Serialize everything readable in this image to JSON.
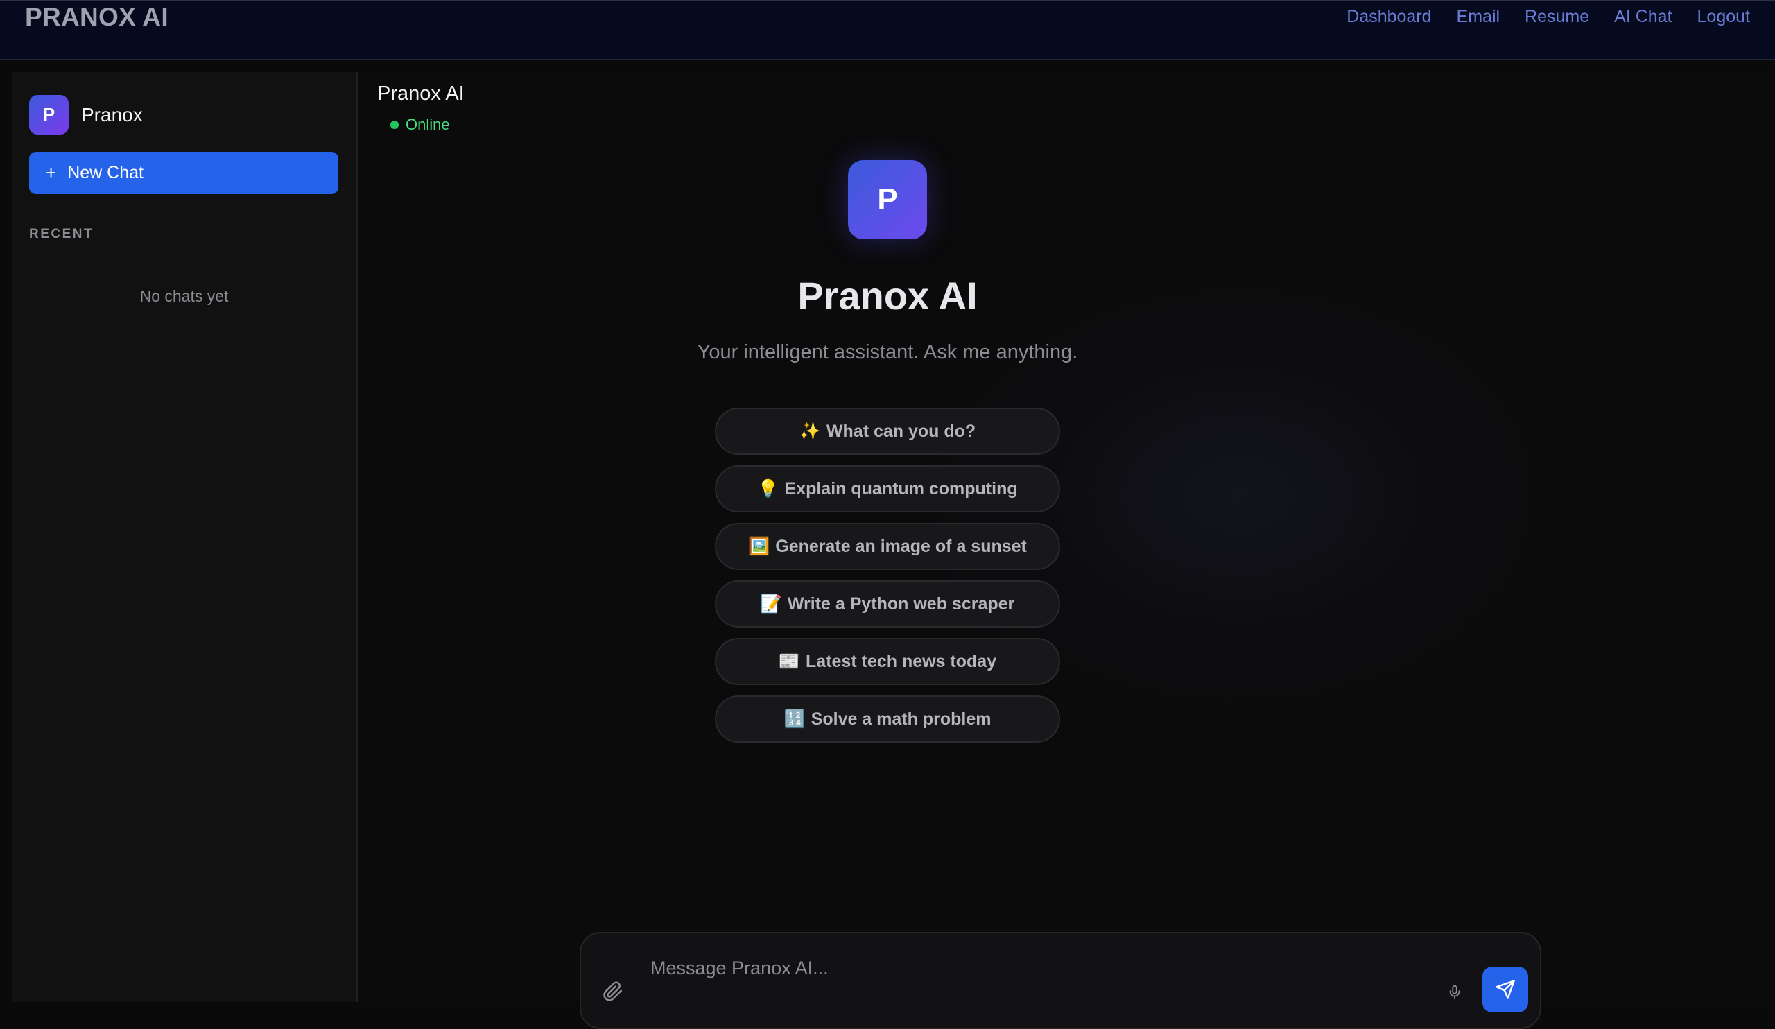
{
  "app": {
    "brand": "PRANOX AI",
    "nav": [
      "Dashboard",
      "Email",
      "Resume",
      "AI Chat",
      "Logout"
    ]
  },
  "sidebar": {
    "avatar_letter": "P",
    "name": "Pranox",
    "new_chat_icon": "+",
    "new_chat_label": "New Chat",
    "recent_heading": "RECENT",
    "empty_text": "No chats yet"
  },
  "chat": {
    "title": "Pranox AI",
    "status": "Online",
    "hero_letter": "P",
    "hero_title": "Pranox AI",
    "hero_subtitle": "Your intelligent assistant. Ask me anything.",
    "suggestions": [
      {
        "emoji": "✨",
        "text": "What can you do?"
      },
      {
        "emoji": "💡",
        "text": "Explain quantum computing"
      },
      {
        "emoji": "🖼️",
        "text": "Generate an image of a sunset"
      },
      {
        "emoji": "📝",
        "text": "Write a Python web scraper"
      },
      {
        "emoji": "📰",
        "text": "Latest tech news today"
      },
      {
        "emoji": "🔢",
        "text": "Solve a math problem"
      }
    ]
  },
  "composer": {
    "placeholder": "Message Pranox AI...",
    "value": "",
    "icons": {
      "attach": "paperclip-icon",
      "mic": "microphone-icon",
      "send": "send-icon"
    }
  },
  "colors": {
    "accent": "#2563eb",
    "avatar_gradient_start": "#3b5bdb",
    "avatar_gradient_end": "#7c3aed",
    "status_online": "#22c55e",
    "nav_link": "#6b7dd6"
  }
}
